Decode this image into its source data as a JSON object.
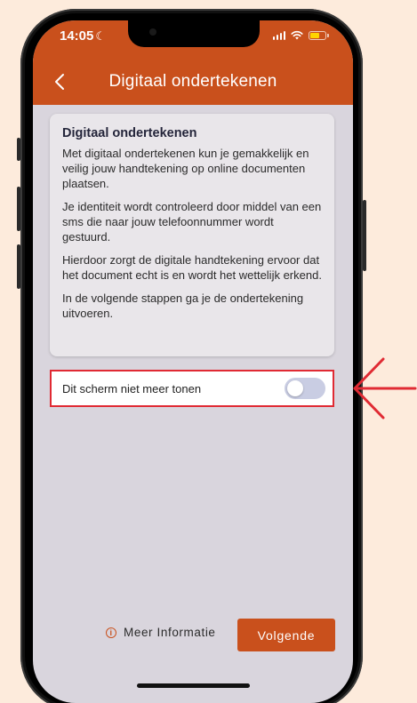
{
  "status_bar": {
    "time": "14:05",
    "moon_icon": "moon-icon",
    "signal_icon": "cellular-signal-icon",
    "wifi_icon": "wifi-icon",
    "battery_icon": "battery-icon",
    "battery_color": "#ffd400"
  },
  "app_bar": {
    "title": "Digitaal ondertekenen",
    "back_icon": "chevron-left-icon",
    "color": "#c9501c"
  },
  "info_card": {
    "title": "Digitaal ondertekenen",
    "paragraphs": [
      "Met digitaal ondertekenen kun je gemakkelijk en veilig jouw handtekening op online documenten plaatsen.",
      "Je identiteit wordt controleerd door middel van een sms die naar jouw telefoonnummer wordt gestuurd.",
      "Hierdoor zorgt de digitale handtekening ervoor dat het document echt is en wordt het wettelijk erkend.",
      "In de volgende stappen ga je de ondertekening uitvoeren."
    ]
  },
  "toggle": {
    "label": "Dit scherm niet meer tonen",
    "enabled": false,
    "highlight_color": "#e02a33"
  },
  "footer": {
    "info_label": "Meer Informatie",
    "info_icon": "info-circle-icon",
    "next_label": "Volgende"
  },
  "annotation": {
    "arrow_icon": "arrow-left-icon",
    "color": "#e02a33"
  }
}
